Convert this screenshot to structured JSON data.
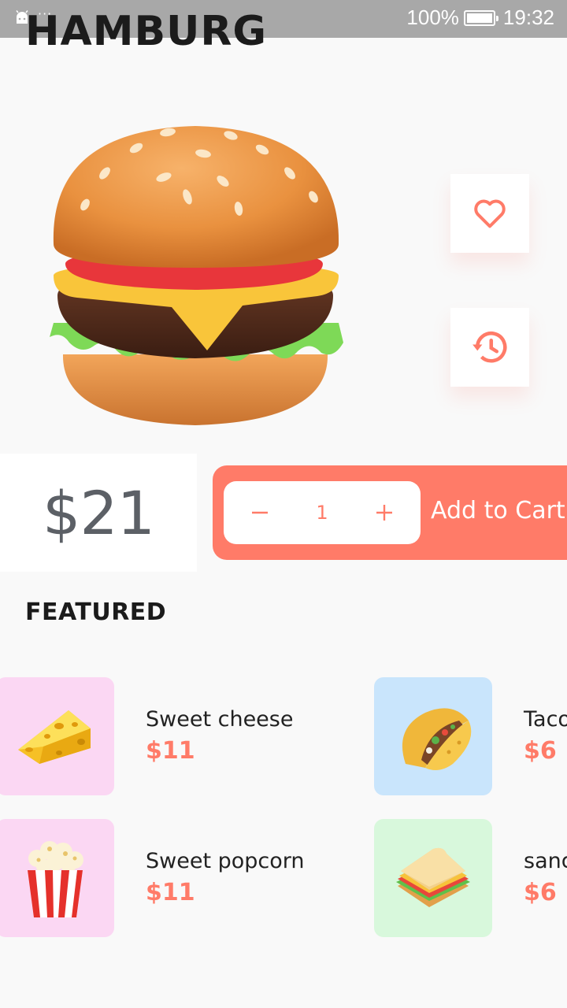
{
  "status_bar": {
    "dots": "···",
    "battery": "100%",
    "time": "19:32"
  },
  "page_title": "HAMBURG",
  "product": {
    "price": "$21",
    "quantity": "1",
    "add_to_cart_label": "Add to Cart",
    "icon": "hamburger-icon"
  },
  "featured": {
    "title": "FEATURED",
    "items": [
      {
        "name": "Sweet cheese",
        "price": "$11",
        "icon": "cheese-icon",
        "bg": "#fbd7f3"
      },
      {
        "name": "Tacos",
        "price": "$6",
        "icon": "taco-icon",
        "bg": "#c9e5fc"
      },
      {
        "name": "Sweet popcorn",
        "price": "$11",
        "icon": "popcorn-icon",
        "bg": "#fbd7f3"
      },
      {
        "name": "sandwich",
        "price": "$6",
        "icon": "sandwich-icon",
        "bg": "#d8f8dc"
      }
    ]
  },
  "colors": {
    "accent": "#ff7b68",
    "price_text": "#5c6066",
    "status_bar": "#a8a8a8"
  }
}
